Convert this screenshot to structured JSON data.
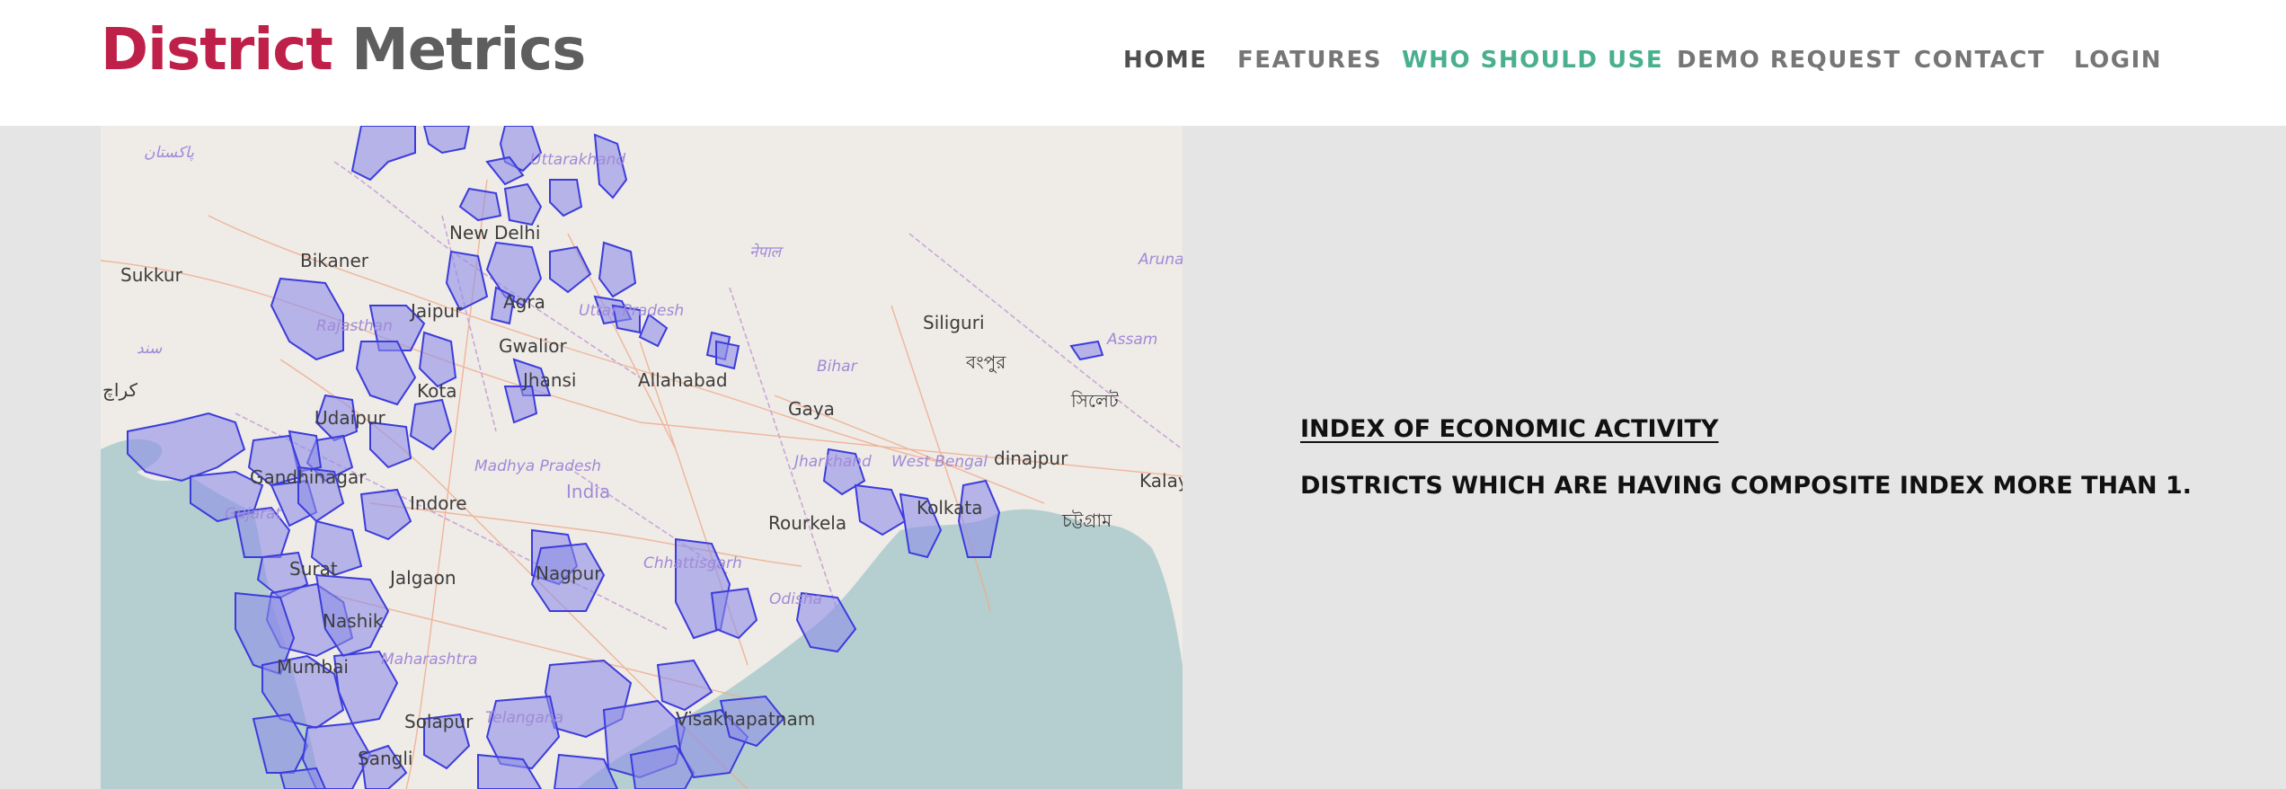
{
  "header": {
    "logo": {
      "word1": "District",
      "word2": "Metrics"
    },
    "nav": [
      {
        "label": "HOME"
      },
      {
        "label": "FEATURES"
      },
      {
        "label": "WHO SHOULD USE"
      },
      {
        "label": "DEMO REQUEST"
      },
      {
        "label": "CONTACT"
      },
      {
        "label": "LOGIN"
      }
    ],
    "active_nav": "WHO SHOULD USE"
  },
  "map": {
    "city_labels": [
      "New Delhi",
      "Bikaner",
      "Sukkur",
      "Jaipur",
      "Agra",
      "Gwalior",
      "Jhansi",
      "Allahabad",
      "Kota",
      "Udaipur",
      "Gandhinagar",
      "Indore",
      "Surat",
      "Jalgaon",
      "Nagpur",
      "Nashik",
      "Mumbai",
      "Solapur",
      "Sangli",
      "Gaya",
      "Siliguri",
      "Rourkela",
      "Kolkata",
      "Visakhapatnam",
      "dinajpur",
      "Kalay",
      "India"
    ],
    "state_labels": [
      "Uttarakhand",
      "Uttar Pradesh",
      "Rajasthan",
      "Bihar",
      "Assam",
      "Madhya Pradesh",
      "Jharkhand",
      "West Bengal",
      "Chhattisgarh",
      "Odisha",
      "Maharashtra",
      "Gujarat",
      "Telangana",
      "Aruna"
    ],
    "script_labels": [
      "پاکستان",
      "नेपाल",
      "বংপুর",
      "সিলেট",
      "চট্টগ্রাম",
      "سند",
      "كراچ"
    ],
    "highlight_color": "#8e8ee8",
    "highlight_border": "#3c3cdc",
    "water_color": "#b5cfd0",
    "land_color": "#efebe6"
  },
  "content": {
    "title": "INDEX OF ECONOMIC ACTIVITY",
    "description": "DISTRICTS WHICH ARE HAVING COMPOSITE INDEX MORE THAN 1."
  },
  "colors": {
    "brand_red": "#be2049",
    "brand_gray": "#5e5e5e",
    "nav_active": "#4aaf8f",
    "background": "#e5e5e5"
  }
}
